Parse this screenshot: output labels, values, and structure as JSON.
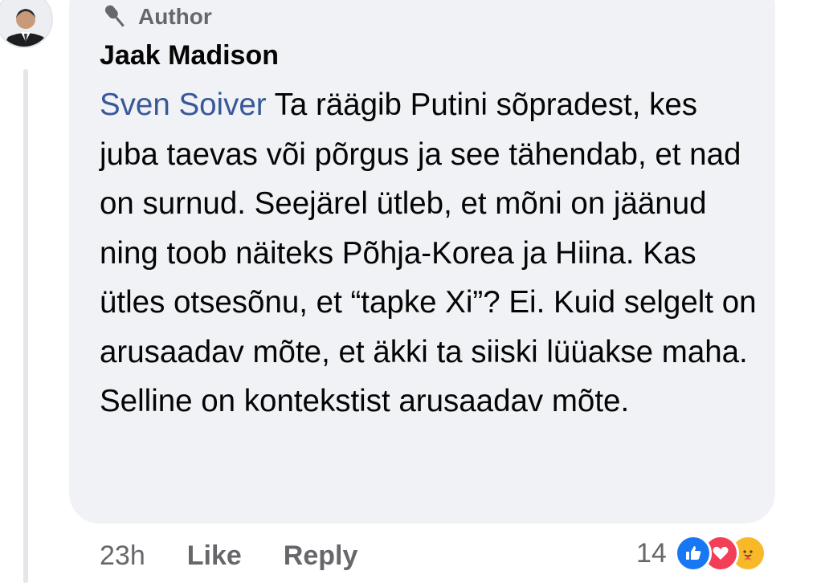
{
  "comment": {
    "author_badge": "Author",
    "name": "Jaak Madison",
    "mention": "Sven Soiver",
    "text": " Ta räägib Putini sõpradest, kes juba taevas või põrgus ja see tähendab, et nad on surnud. Seejärel ütleb, et mõni on jäänud ning toob näiteks Põhja-Korea ja Hiina. Kas ütles otsesõnu, et “tapke Xi”? Ei. Kuid selgelt on arusaadav mõte, et äkki ta siiski lüüakse maha. Selline on kontekstist arusaadav mõte."
  },
  "footer": {
    "time": "23h",
    "like_label": "Like",
    "reply_label": "Reply",
    "reaction_count": "14",
    "reactions": [
      "like-icon",
      "love-icon",
      "care-icon"
    ]
  },
  "colors": {
    "bubble": "#f0f2f5",
    "mention": "#385898",
    "meta": "#65676b",
    "like": "#1877f2",
    "love": "#f33e58",
    "care": "#f7b928"
  }
}
